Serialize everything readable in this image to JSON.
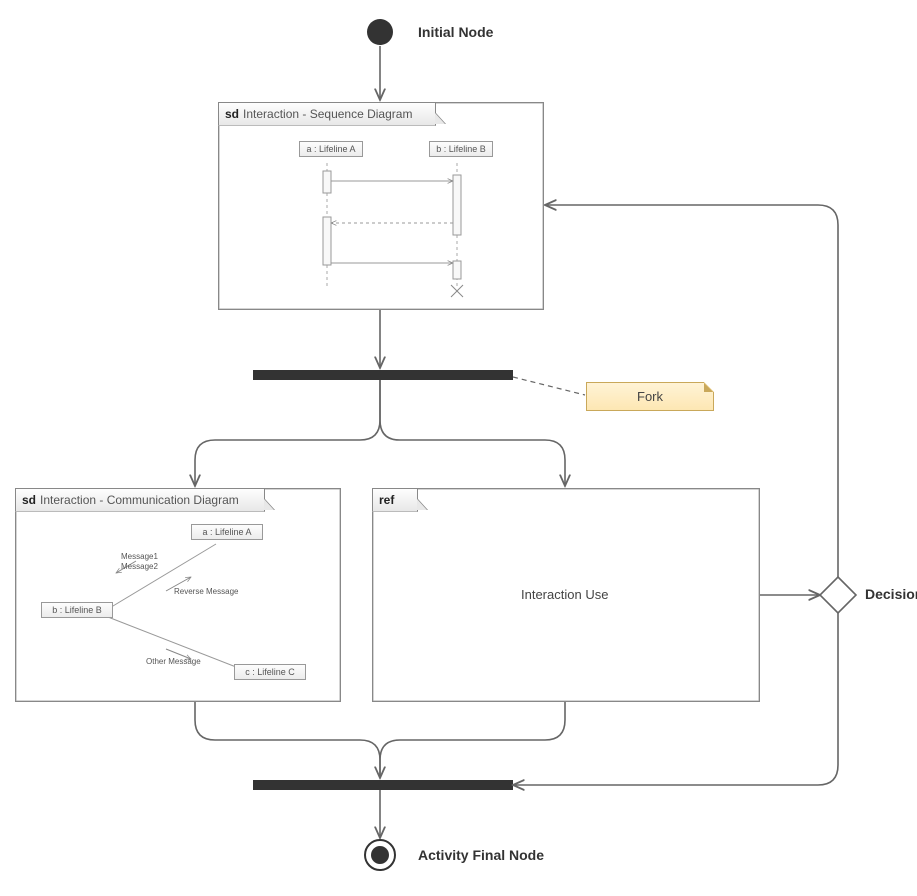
{
  "initial_node_label": "Initial Node",
  "final_node_label": "Activity Final Node",
  "decision_label": "Decision",
  "fork_note": "Fork",
  "seq_frame": {
    "tag": "sd",
    "title": "Interaction - Sequence Diagram",
    "lifeline_a": "a : Lifeline A",
    "lifeline_b": "b : Lifeline B"
  },
  "comm_frame": {
    "tag": "sd",
    "title": "Interaction - Communication Diagram",
    "lifeline_a": "a : Lifeline A",
    "lifeline_b": "b : Lifeline B",
    "lifeline_c": "c : Lifeline C",
    "msg1": "Message1",
    "msg2": "Message2",
    "rev": "Reverse Message",
    "other": "Other Message"
  },
  "ref_frame": {
    "tag": "ref",
    "title": "Interaction Use"
  }
}
